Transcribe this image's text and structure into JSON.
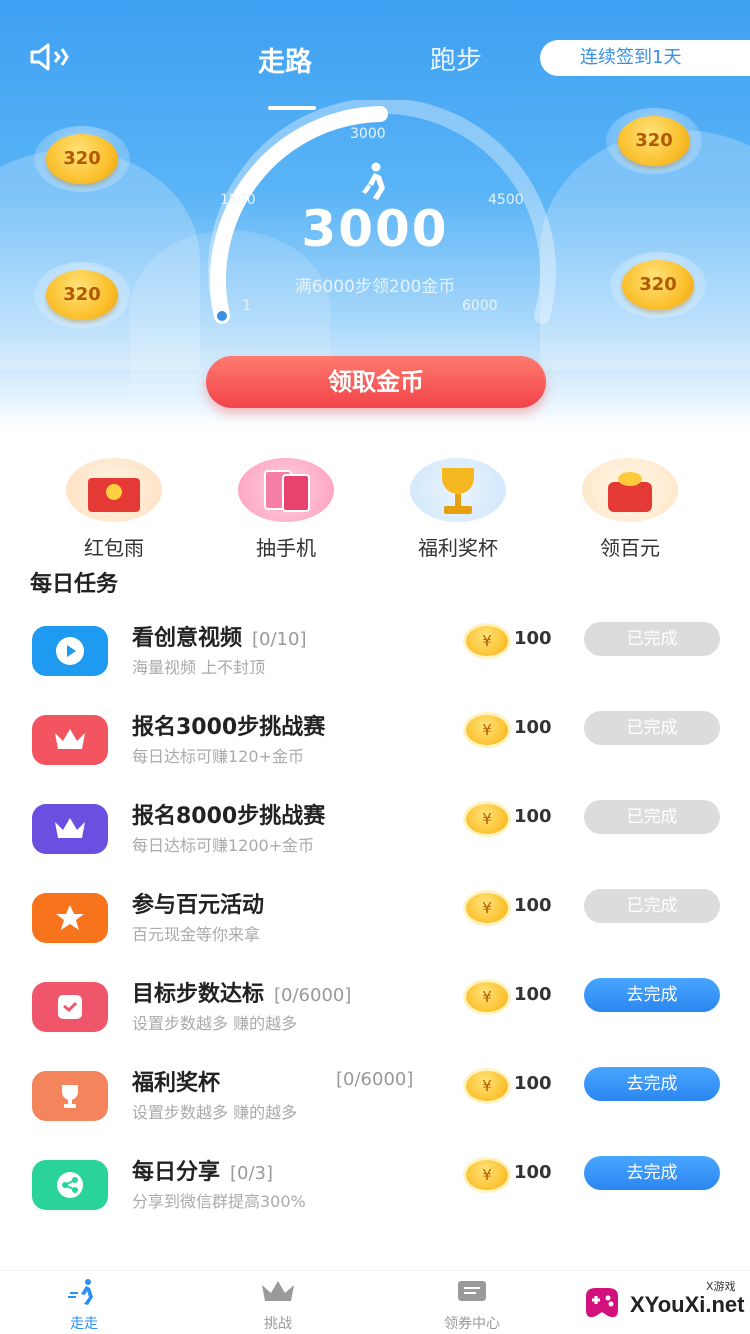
{
  "header": {
    "tabs": [
      {
        "label": "走路",
        "active": true
      },
      {
        "label": "跑步",
        "active": false
      }
    ],
    "signin_label": "连续签到1天"
  },
  "pedometer": {
    "steps": "3000",
    "goal_text": "满6000步领200金币",
    "ticks": [
      "3000",
      "1500",
      "4500",
      "1",
      "6000"
    ]
  },
  "coins": [
    "320",
    "320",
    "320",
    "320"
  ],
  "claim_button": "领取金币",
  "quick_entries": [
    {
      "label": "红包雨",
      "icon": "red-envelope-icon"
    },
    {
      "label": "抽手机",
      "icon": "phone-lottery-icon"
    },
    {
      "label": "福利奖杯",
      "icon": "trophy-icon"
    },
    {
      "label": "领百元",
      "icon": "money-bag-icon"
    }
  ],
  "daily_tasks": {
    "title": "每日任务",
    "items": [
      {
        "name": "看创意视频",
        "progress": "[0/10]",
        "desc": "海量视频 上不封顶",
        "coin": "¥",
        "reward": "100",
        "button": "已完成",
        "status": "done",
        "color": "#1e9bf0"
      },
      {
        "name": "报名3000步挑战赛",
        "progress": "",
        "desc": "每日达标可赚120+金币",
        "coin": "¥",
        "reward": "100",
        "button": "已完成",
        "status": "done",
        "color": "#f2555f"
      },
      {
        "name": "报名8000步挑战赛",
        "progress": "",
        "desc": "每日达标可赚1200+金币",
        "coin": "¥",
        "reward": "100",
        "button": "已完成",
        "status": "done",
        "color": "#6b4fe0"
      },
      {
        "name": "参与百元活动",
        "progress": "",
        "desc": "百元现金等你来拿",
        "coin": "¥",
        "reward": "100",
        "button": "已完成",
        "status": "done",
        "color": "#f7741c"
      },
      {
        "name": "目标步数达标",
        "progress": "[0/6000]",
        "desc": "设置步数越多 赚的越多",
        "coin": "¥",
        "reward": "100",
        "button": "去完成",
        "status": "todo",
        "color": "#f0566b"
      },
      {
        "name": "福利奖杯",
        "progress": "[0/6000]",
        "desc": "设置步数越多 赚的越多",
        "coin": "¥",
        "reward": "100",
        "button": "去完成",
        "status": "todo",
        "color": "#f4845c"
      },
      {
        "name": "每日分享",
        "progress": "[0/3]",
        "desc": "分享到微信群提高300%",
        "coin": "¥",
        "reward": "100",
        "button": "去完成",
        "status": "todo",
        "color": "#2ad39a"
      }
    ]
  },
  "tabbar": [
    {
      "label": "走走",
      "icon": "walk-icon",
      "active": true
    },
    {
      "label": "挑战",
      "icon": "crown-icon",
      "active": false
    },
    {
      "label": "领券中心",
      "icon": "coupon-icon",
      "active": false
    }
  ],
  "watermark": {
    "text": "XYouXi.net",
    "small": "X游戏"
  }
}
